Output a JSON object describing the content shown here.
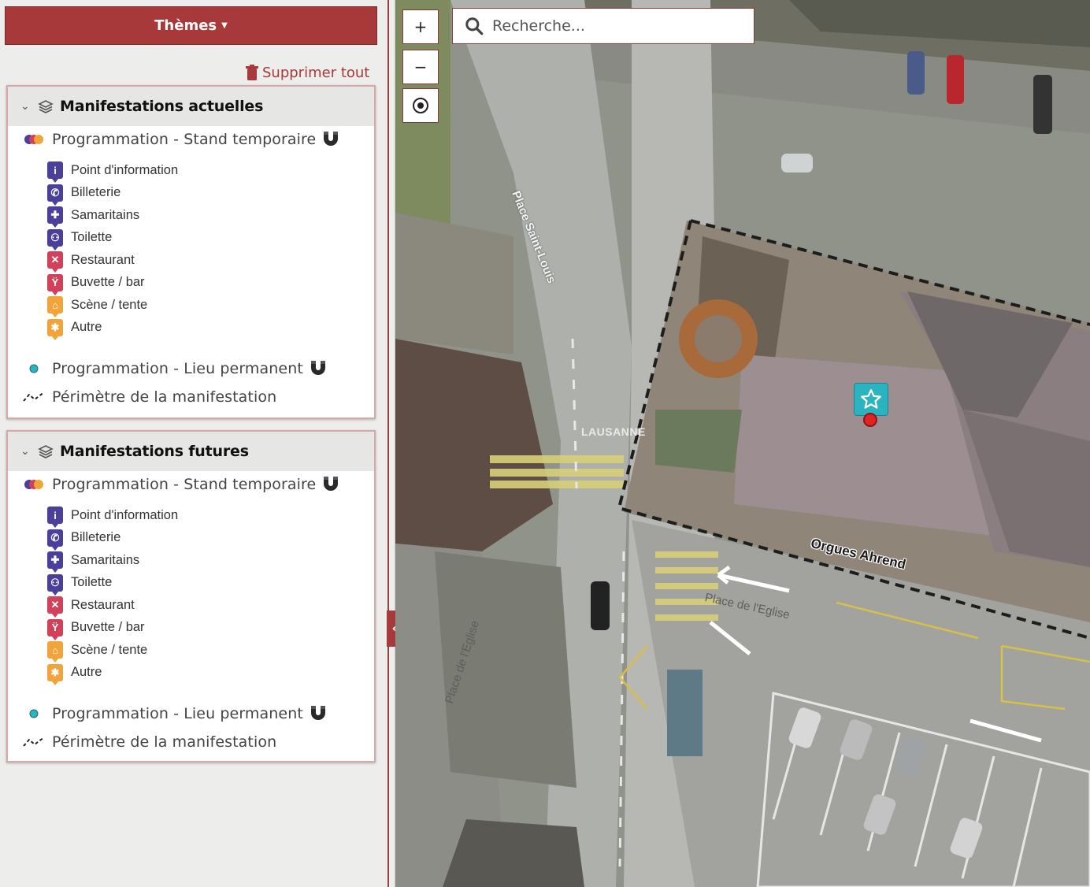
{
  "sidebar": {
    "themes_label": "Thèmes",
    "delete_all_label": "Supprimer tout",
    "collapse_label": "«",
    "panels": [
      {
        "title": "Manifestations actuelles",
        "stand_label": "Programmation - Stand temporaire",
        "items": [
          {
            "label": "Point d'information",
            "icon": "info-icon",
            "color": "#4a3f9a",
            "glyph": "i"
          },
          {
            "label": "Billeterie",
            "icon": "ticket-icon",
            "color": "#4a3f9a",
            "glyph": "✆"
          },
          {
            "label": "Samaritains",
            "icon": "first-aid-icon",
            "color": "#4a3f9a",
            "glyph": "✚"
          },
          {
            "label": "Toilette",
            "icon": "toilet-icon",
            "color": "#4a3f9a",
            "glyph": "⚇"
          },
          {
            "label": "Restaurant",
            "icon": "restaurant-icon",
            "color": "#d2415a",
            "glyph": "✕"
          },
          {
            "label": "Buvette / bar",
            "icon": "bar-icon",
            "color": "#d2415a",
            "glyph": "Ÿ"
          },
          {
            "label": "Scène / tente",
            "icon": "stage-icon",
            "color": "#f0a43a",
            "glyph": "⌂"
          },
          {
            "label": "Autre",
            "icon": "other-icon",
            "color": "#f0a43a",
            "glyph": "✱"
          }
        ],
        "permanent_label": "Programmation - Lieu permanent",
        "perimeter_label": "Périmètre de la manifestation"
      },
      {
        "title": "Manifestations futures",
        "stand_label": "Programmation - Stand temporaire",
        "items": [
          {
            "label": "Point d'information",
            "icon": "info-icon",
            "color": "#4a3f9a",
            "glyph": "i"
          },
          {
            "label": "Billeterie",
            "icon": "ticket-icon",
            "color": "#4a3f9a",
            "glyph": "✆"
          },
          {
            "label": "Samaritains",
            "icon": "first-aid-icon",
            "color": "#4a3f9a",
            "glyph": "✚"
          },
          {
            "label": "Toilette",
            "icon": "toilet-icon",
            "color": "#4a3f9a",
            "glyph": "⚇"
          },
          {
            "label": "Restaurant",
            "icon": "restaurant-icon",
            "color": "#d2415a",
            "glyph": "✕"
          },
          {
            "label": "Buvette / bar",
            "icon": "bar-icon",
            "color": "#d2415a",
            "glyph": "Ÿ"
          },
          {
            "label": "Scène / tente",
            "icon": "stage-icon",
            "color": "#f0a43a",
            "glyph": "⌂"
          },
          {
            "label": "Autre",
            "icon": "other-icon",
            "color": "#f0a43a",
            "glyph": "✱"
          }
        ],
        "permanent_label": "Programmation - Lieu permanent",
        "perimeter_label": "Périmètre de la manifestation"
      }
    ]
  },
  "map": {
    "zoom_in_label": "+",
    "zoom_out_label": "−",
    "search_placeholder": "Recherche...",
    "labels": {
      "street_saint_louis": "Place Saint-Louis",
      "street_eglise_1": "Place de l'Eglise",
      "street_eglise_2": "Place de l'Eglise",
      "road_marking": "LAUSANNE",
      "poi_name": "Orgues Ahrend"
    },
    "accent_color": "#a7393a",
    "marker_color": "#2bb3c0"
  }
}
